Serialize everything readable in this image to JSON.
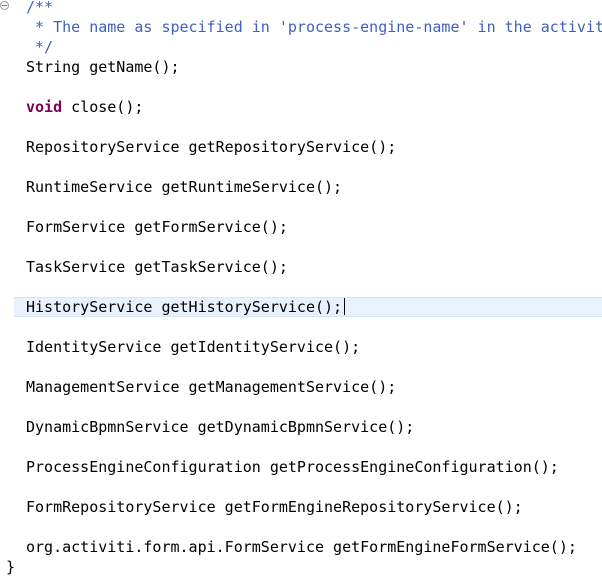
{
  "editor": {
    "comment_start": "/**",
    "comment_body": " * The name as specified in 'process-engine-name' in the activit",
    "comment_end": " */",
    "lines": {
      "get_name": "String getName();",
      "close_keyword": "void",
      "close_rest": " close();",
      "repository": "RepositoryService getRepositoryService();",
      "runtime": "RuntimeService getRuntimeService();",
      "form": "FormService getFormService();",
      "task": "TaskService getTaskService();",
      "history": "HistoryService getHistoryService();",
      "identity": "IdentityService getIdentityService();",
      "management": "ManagementService getManagementService();",
      "dynamic_bpmn": "DynamicBpmnService getDynamicBpmnService();",
      "process_engine_config": "ProcessEngineConfiguration getProcessEngineConfiguration();",
      "form_repository": "FormRepositoryService getFormEngineRepositoryService();",
      "form_engine_form": "org.activiti.form.api.FormService getFormEngineFormService();"
    },
    "closing_brace": "}"
  }
}
